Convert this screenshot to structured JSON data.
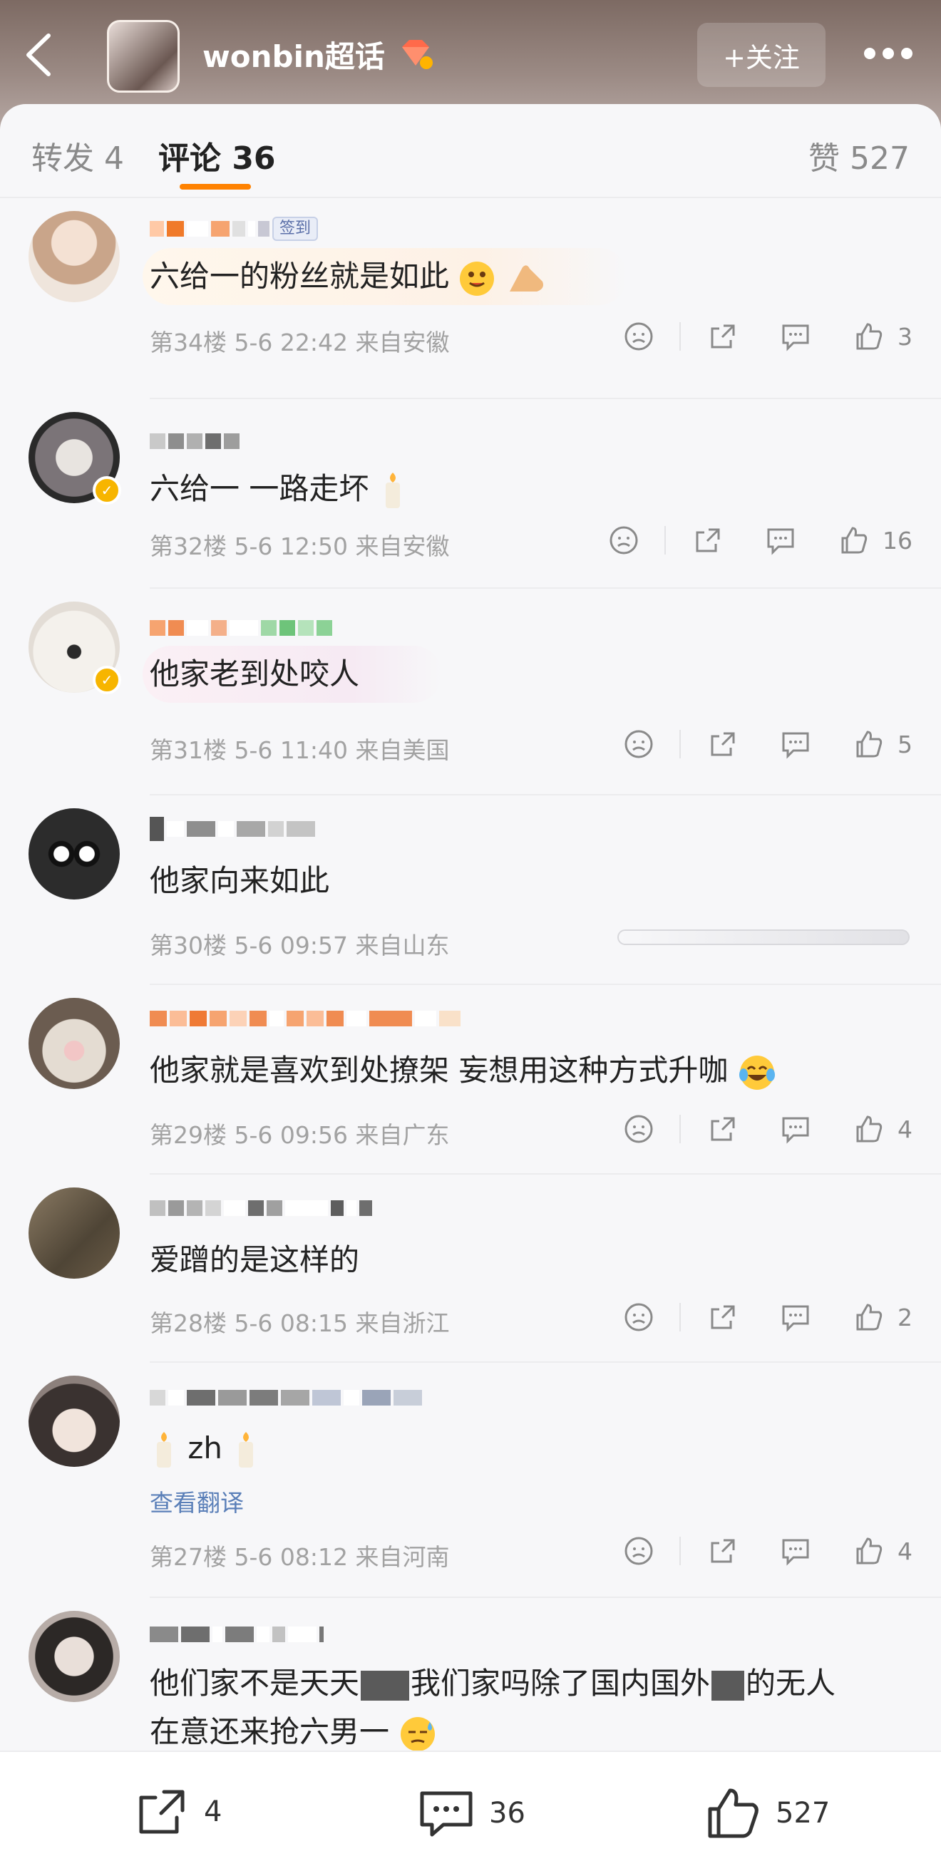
{
  "header": {
    "topic_title": "wonbin超话",
    "follow_label": "+关注"
  },
  "tabs": {
    "repost": "转发 4",
    "comments": "评论 36",
    "likes": "赞 527"
  },
  "comments": [
    {
      "text": "六给一的粉丝就是如此",
      "meta": "第34楼 5-6 22:42 来自安徽",
      "likes": "3",
      "badge": "签到"
    },
    {
      "text": "六给一 一路走坏",
      "meta": "第32楼 5-6 12:50 来自安徽",
      "likes": "16"
    },
    {
      "text": "他家老到处咬人",
      "meta": "第31楼 5-6 11:40 来自美国",
      "likes": "5"
    },
    {
      "text": "他家向来如此",
      "meta": "第30楼 5-6 09:57 来自山东",
      "likes": ""
    },
    {
      "text": "他家就是喜欢到处撩架 妄想用这种方式升咖",
      "meta": "第29楼 5-6 09:56 来自广东",
      "likes": "4"
    },
    {
      "text": "爱蹭的是这样的",
      "meta": "第28楼 5-6 08:15 来自浙江",
      "likes": "2"
    },
    {
      "text": "zh",
      "translate": "查看翻译",
      "meta": "第27楼 5-6 08:12 来自河南",
      "likes": "4"
    },
    {
      "text_line1": "他们家不是天天",
      "text_line1b": "我们家吗除了国内国外",
      "text_line1c": "的无人",
      "text_line2": "在意还来抢六男一"
    }
  ],
  "bottom_bar": {
    "repost_count": "4",
    "comment_count": "36",
    "like_count": "527"
  },
  "colors": {
    "accent": "#ff8200",
    "verified": "#f7b500",
    "link": "#5a7fb8"
  }
}
